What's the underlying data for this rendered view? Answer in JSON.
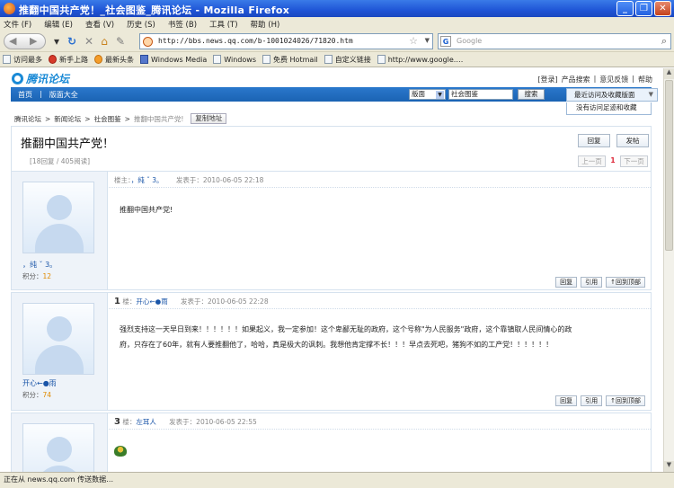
{
  "window": {
    "title": "推翻中国共产党！_社会图鉴_腾讯论坛 - Mozilla Firefox",
    "buttons": [
      "_",
      "❐",
      "✕"
    ]
  },
  "menubar": [
    "文件 (F)",
    "编辑 (E)",
    "查看 (V)",
    "历史 (S)",
    "书签 (B)",
    "工具 (T)",
    "帮助 (H)"
  ],
  "navbar": {
    "url": "http://bbs.news.qq.com/b-1001024026/71820.htm",
    "search_placeholder": "Google"
  },
  "bookmarks": [
    {
      "label": "访问最多",
      "icon": "page-icon"
    },
    {
      "label": "新手上路",
      "icon": "firefox-icon"
    },
    {
      "label": "最新头条",
      "icon": "rss-icon"
    },
    {
      "label": "Windows Media",
      "icon": "windows-icon"
    },
    {
      "label": "Windows",
      "icon": "page-icon"
    },
    {
      "label": "免费 Hotmail",
      "icon": "page-icon"
    },
    {
      "label": "自定义链接",
      "icon": "page-icon"
    },
    {
      "label": "http://www.google.…",
      "icon": "page-icon"
    }
  ],
  "site": {
    "logo": "腾讯论坛",
    "toplinks": [
      "[登录]",
      "产品搜索",
      "|",
      "意见反馈",
      "|",
      "帮助"
    ],
    "nav": [
      "首页",
      "|",
      "版面大全"
    ],
    "search_scope": "版面",
    "search_keyword": "社会图鉴",
    "search_button": "搜索",
    "recent_button": "最近访问及收藏版面",
    "recent_empty": "没有访问足迹和收藏"
  },
  "breadcrumb": {
    "items": [
      "腾讯论坛",
      ">",
      "新闻论坛",
      ">",
      "社会图鉴",
      ">"
    ],
    "current": "推翻中国共产党!",
    "copy_button": "复制地址"
  },
  "thread": {
    "title": "推翻中国共产党！",
    "stats": "[18回复 / 405阅读]",
    "reply_button": "回复",
    "post_button": "发帖",
    "prev_page": "上一页",
    "current_page": "1",
    "next_page": "下一页"
  },
  "posts": [
    {
      "floor": "",
      "floor_label": "楼主：",
      "author": "，纯 ˇ 3。",
      "posted_label": "发表于：",
      "time": "2010-06-05 22:18",
      "username": "，纯 ˇ 3。",
      "score_label": "积分：",
      "score": "12",
      "content": "推翻中国共产党!"
    },
    {
      "floor": "1",
      "floor_label": "楼：",
      "author": "开心←●雨",
      "posted_label": "发表于：",
      "time": "2010-06-05 22:28",
      "username": "开心←●雨",
      "score_label": "积分：",
      "score": "74",
      "content_line1": "强烈支持这一天早日到来！！！！！！如果起义，我一定参加！这个卑鄙无耻的政府，这个号称\"为人民服务\"政府，这个靠镇取人民间情心的政",
      "content_line2": "府，只存在了60年，就有人要推翻他了，哈哈，真是极大的讽刺。我想他肯定撑不长！！！早点去死吧，猪狗不如的工产党！！！！！！"
    },
    {
      "floor": "3",
      "floor_label": "楼：",
      "author": "左耳人",
      "posted_label": "发表于：",
      "time": "2010-06-05 22:55"
    }
  ],
  "post_actions": [
    "回复",
    "引用",
    "↑回到顶部"
  ],
  "statusbar": "正在从 news.qq.com 传送数据…"
}
